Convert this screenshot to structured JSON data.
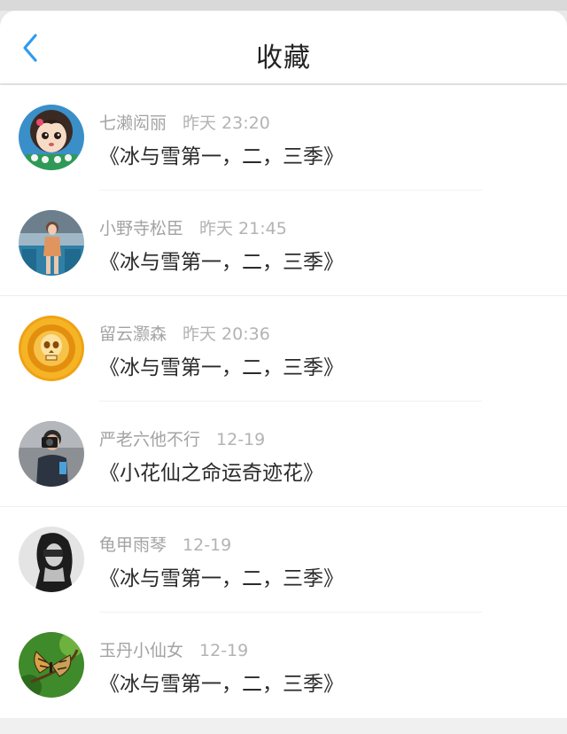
{
  "header": {
    "title": "收藏",
    "back_icon": "chevron-left-icon",
    "accent_color": "#2f9bf0"
  },
  "favorites": [
    {
      "user": "七濑闳丽",
      "time": "昨天 23:20",
      "work": "《冰与雪第一，二，三季》",
      "avatar": "cartoon-girl-avatar"
    },
    {
      "user": "小野寺松臣",
      "time": "昨天 21:45",
      "work": "《冰与雪第一，二，三季》",
      "avatar": "photo-person-avatar"
    },
    {
      "user": "留云灏森",
      "time": "昨天 20:36",
      "work": "《冰与雪第一，二，三季》",
      "avatar": "golden-skull-avatar"
    },
    {
      "user": "严老六他不行",
      "time": "12-19",
      "work": "《小花仙之命运奇迹花》",
      "avatar": "camera-person-avatar"
    },
    {
      "user": "龟甲雨琴",
      "time": "12-19",
      "work": "《冰与雪第一，二，三季》",
      "avatar": "bw-portrait-avatar"
    },
    {
      "user": "玉丹小仙女",
      "time": "12-19",
      "work": "《冰与雪第一，二，三季》",
      "avatar": "butterfly-avatar"
    }
  ]
}
